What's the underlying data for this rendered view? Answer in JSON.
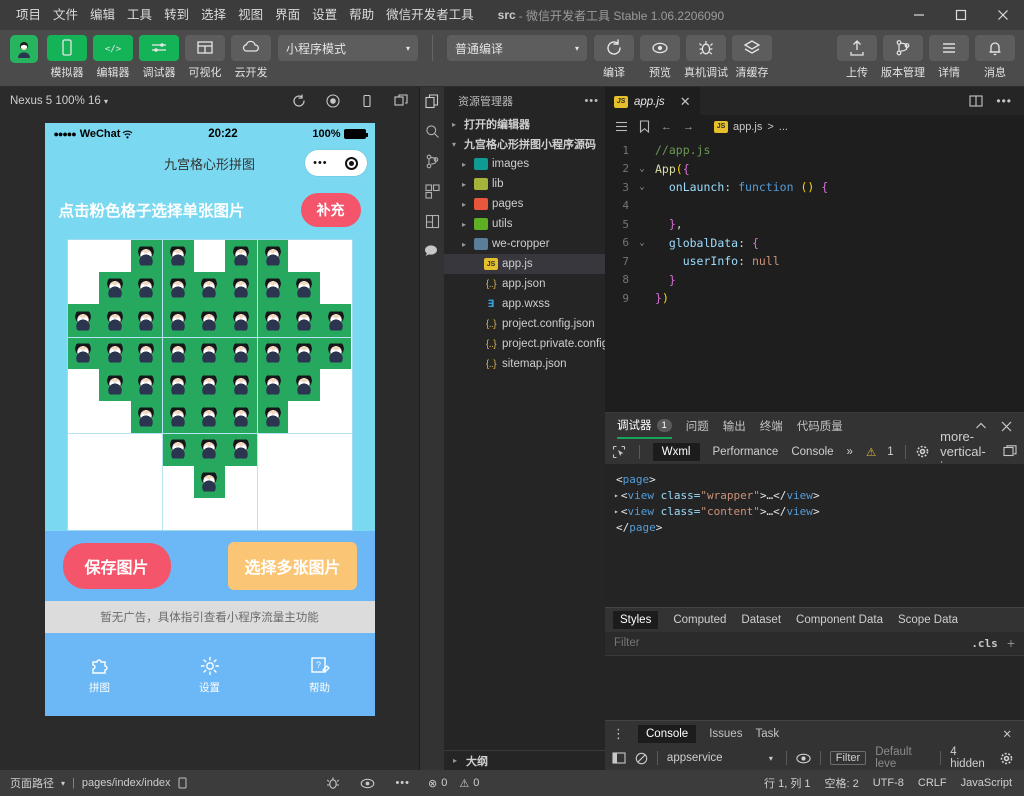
{
  "titlebar": {
    "menus": [
      "项目",
      "文件",
      "编辑",
      "工具",
      "转到",
      "选择",
      "视图",
      "界面",
      "设置",
      "帮助",
      "微信开发者工具"
    ],
    "doc_name": "src",
    "title_rest": "- 微信开发者工具 Stable 1.06.2206090",
    "minimize": "—",
    "maximize": "▢",
    "close": "✕"
  },
  "toolbar": {
    "avatar_icon": "user-avatar",
    "items": [
      {
        "label": "模拟器",
        "icon": "phone-icon",
        "style": "green"
      },
      {
        "label": "编辑器",
        "icon": "code-icon",
        "style": "green"
      },
      {
        "label": "调试器",
        "icon": "sliders-icon",
        "style": "green"
      },
      {
        "label": "可视化",
        "icon": "layout-icon",
        "style": "grey"
      },
      {
        "label": "云开发",
        "icon": "cloud-icon",
        "style": "grey"
      }
    ],
    "mode_select": "小程序模式",
    "compile_select": "普通编译",
    "actions": [
      {
        "label": "编译",
        "icon": "refresh-icon"
      },
      {
        "label": "预览",
        "icon": "eye-icon"
      },
      {
        "label": "真机调试",
        "icon": "bug-icon"
      },
      {
        "label": "清缓存",
        "icon": "layers-icon"
      }
    ],
    "right_actions": [
      {
        "label": "上传",
        "icon": "upload-icon"
      },
      {
        "label": "版本管理",
        "icon": "branch-icon"
      },
      {
        "label": "详情",
        "icon": "menu-icon"
      },
      {
        "label": "消息",
        "icon": "bell-icon"
      }
    ]
  },
  "simulator": {
    "device": "Nexus 5 100% 16",
    "toolbar_icons": [
      "rotate-icon",
      "record-icon",
      "device-icon",
      "copy-icon"
    ],
    "phone": {
      "status": {
        "carrier": "WeChat",
        "dots": "●●●●●",
        "wifi": "wifi-icon",
        "time": "20:22",
        "battery": "100%"
      },
      "nav_title": "九宫格心形拼图",
      "capsule": {
        "dots": "•••",
        "target": "target-icon"
      },
      "hint": "点击粉色格子选择单张图片",
      "supplement_button": "补充",
      "grid": {
        "rows": 9,
        "cols": 9,
        "pattern": [
          [
            0,
            0,
            1,
            1,
            0,
            1,
            1,
            0,
            0
          ],
          [
            0,
            1,
            1,
            1,
            1,
            1,
            1,
            1,
            0
          ],
          [
            1,
            1,
            1,
            1,
            1,
            1,
            1,
            1,
            1
          ],
          [
            1,
            1,
            1,
            1,
            1,
            1,
            1,
            1,
            1
          ],
          [
            0,
            1,
            1,
            1,
            1,
            1,
            1,
            1,
            0
          ],
          [
            0,
            0,
            1,
            1,
            1,
            1,
            1,
            0,
            0
          ],
          [
            0,
            0,
            0,
            1,
            1,
            1,
            0,
            0,
            0
          ],
          [
            0,
            0,
            0,
            0,
            1,
            0,
            0,
            0,
            0
          ],
          [
            0,
            0,
            0,
            0,
            0,
            0,
            0,
            0,
            0
          ]
        ]
      },
      "save_button": "保存图片",
      "multi_button": "选择多张图片",
      "ad_text": "暂无广告，具体指引查看小程序流量主功能",
      "tabs": [
        {
          "label": "拼图",
          "icon": "puzzle-icon"
        },
        {
          "label": "设置",
          "icon": "gear-icon"
        },
        {
          "label": "帮助",
          "icon": "help-icon"
        }
      ]
    }
  },
  "activitybar": {
    "icons": [
      "files-icon",
      "search-icon",
      "source-control-icon",
      "extensions-icon",
      "compile-icon",
      "wechat-icon"
    ]
  },
  "explorer": {
    "title": "资源管理器",
    "more": "•••",
    "tree": [
      {
        "label": "打开的编辑器",
        "indent": 0,
        "arrow": "▸",
        "type": "section"
      },
      {
        "label": "九宫格心形拼图小程序源码",
        "indent": 0,
        "arrow": "▾",
        "type": "section"
      },
      {
        "label": "images",
        "indent": 1,
        "arrow": "▸",
        "type": "folder",
        "color": "teal"
      },
      {
        "label": "lib",
        "indent": 1,
        "arrow": "▸",
        "type": "folder",
        "color": "olive"
      },
      {
        "label": "pages",
        "indent": 1,
        "arrow": "▸",
        "type": "folder",
        "color": "red"
      },
      {
        "label": "utils",
        "indent": 1,
        "arrow": "▸",
        "type": "folder",
        "color": "green"
      },
      {
        "label": "we-cropper",
        "indent": 1,
        "arrow": "▸",
        "type": "folder",
        "color": "blue"
      },
      {
        "label": "app.js",
        "indent": 2,
        "arrow": "",
        "type": "js",
        "selected": true
      },
      {
        "label": "app.json",
        "indent": 2,
        "arrow": "",
        "type": "json"
      },
      {
        "label": "app.wxss",
        "indent": 2,
        "arrow": "",
        "type": "wxss"
      },
      {
        "label": "project.config.json",
        "indent": 2,
        "arrow": "",
        "type": "json"
      },
      {
        "label": "project.private.config.js...",
        "indent": 2,
        "arrow": "",
        "type": "json"
      },
      {
        "label": "sitemap.json",
        "indent": 2,
        "arrow": "",
        "type": "json"
      }
    ],
    "outline": {
      "arrow": "▸",
      "label": "大纲"
    }
  },
  "editor": {
    "tab": {
      "label": "app.js",
      "icon": "js-icon",
      "close": "✕"
    },
    "tab_actions": [
      "split-editor-icon",
      "more-icon"
    ],
    "breadcrumb": {
      "icons": [
        "list-icon",
        "bookmark-icon",
        "back-arrow-icon",
        "forward-arrow-icon"
      ],
      "file": "app.js",
      "sep": ">",
      "rest": "..."
    },
    "lines": [
      {
        "n": "1",
        "fold": "",
        "text": "//app.js",
        "cls": "c-com"
      },
      {
        "n": "2",
        "fold": "⌄",
        "text": "App({",
        "cls": "c-fn"
      },
      {
        "n": "3",
        "fold": "⌄",
        "text": "  onLaunch: function () {",
        "cls": "c-prop"
      },
      {
        "n": "4",
        "fold": "",
        "text": "",
        "cls": ""
      },
      {
        "n": "5",
        "fold": "",
        "text": "  },",
        "cls": "c-pun"
      },
      {
        "n": "6",
        "fold": "⌄",
        "text": "  globalData: {",
        "cls": "c-prop"
      },
      {
        "n": "7",
        "fold": "",
        "text": "    userInfo: null",
        "cls": "c-prop"
      },
      {
        "n": "8",
        "fold": "",
        "text": "  }",
        "cls": "c-pun"
      },
      {
        "n": "9",
        "fold": "",
        "text": "})",
        "cls": "c-pun"
      }
    ]
  },
  "debugger": {
    "tabs": [
      {
        "label": "调试器",
        "badge": "1",
        "active": true
      },
      {
        "label": "问题",
        "badge": "",
        "active": false
      },
      {
        "label": "输出",
        "badge": "",
        "active": false
      },
      {
        "label": "终端",
        "badge": "",
        "active": false
      },
      {
        "label": "代码质量",
        "badge": "",
        "active": false
      }
    ],
    "collapse_icon": "chevron-up-icon",
    "close_icon": "close-icon",
    "devtools": {
      "inspect_icon": "inspect-icon",
      "tabs": [
        "Wxml",
        "Performance",
        "Console"
      ],
      "overflow": "»",
      "warning_icon": "warning-icon",
      "warning_count": "1",
      "gear_icon": "gear-icon",
      "kebab_icon": "more-vertical-icon",
      "dock_icon": "dock-icon"
    },
    "wxml": [
      {
        "tri": "",
        "text": "<page>"
      },
      {
        "tri": "▸",
        "text": "<view class=\"wrapper\">…</view>"
      },
      {
        "tri": "▸",
        "text": "<view class=\"content\">…</view>"
      },
      {
        "tri": "",
        "text": "</page>"
      }
    ],
    "styles_tabs": [
      "Styles",
      "Computed",
      "Dataset",
      "Component Data",
      "Scope Data"
    ],
    "filter_placeholder": "Filter",
    "cls_label": ".cls",
    "plus_label": "+"
  },
  "console": {
    "kebab": "⋮",
    "tabs": [
      "Console",
      "Issues",
      "Task"
    ],
    "close": "✕",
    "sidebar_icon": "sidebar-icon",
    "clear_icon": "clear-icon",
    "source": "appservice",
    "chevron": "▾",
    "eye_icon": "eye-icon",
    "filter_chip": "Filter",
    "level": "Default leve",
    "hidden": "4 hidden",
    "gear_icon": "gear-icon"
  },
  "statusbar": {
    "page_path_label": "页面路径",
    "chevron": "▾",
    "divider": "|",
    "page_path": "pages/index/index",
    "copy_icon": "copy-icon",
    "left_icons": [
      "bug-icon",
      "eye-icon",
      "more-icon"
    ],
    "problems": {
      "error_icon": "⊗",
      "errors": "0",
      "warn_icon": "⚠",
      "warnings": "0"
    },
    "right": [
      "行 1, 列 1",
      "空格: 2",
      "UTF-8",
      "CRLF",
      "JavaScript"
    ]
  },
  "colors": {
    "accent_green": "#15b358",
    "phone_bg": "#7ad9f0",
    "grid_green": "#26a85e",
    "pink": "#f4556b",
    "orange": "#fac675",
    "blue": "#6cb7f5"
  }
}
